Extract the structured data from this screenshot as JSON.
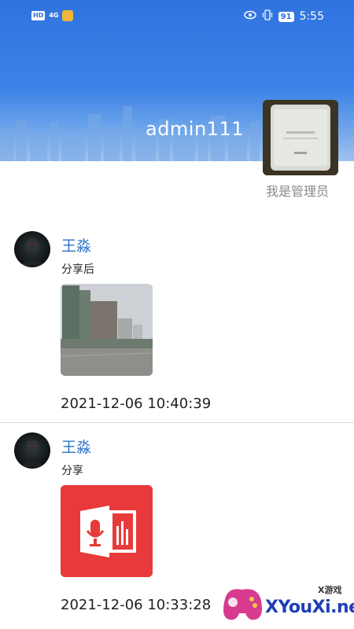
{
  "status_bar": {
    "hd": "HD",
    "network": "4G",
    "battery": "91",
    "time": "5:55"
  },
  "profile": {
    "username": "admin111",
    "role": "我是管理员"
  },
  "posts": [
    {
      "author": "王淼",
      "text": "分享后",
      "image": "building-photo",
      "time": "2021-12-06 10:40:39"
    },
    {
      "author": "王淼",
      "text": "分享",
      "image": "audio-document-app-icon",
      "time": "2021-12-06 10:33:28"
    }
  ],
  "watermark": {
    "site": "XYouXi.net",
    "tag": "X游戏"
  },
  "colors": {
    "header_blue": "#3d82e6",
    "name_blue": "#2a73c9",
    "app_red": "#e83a3a"
  }
}
